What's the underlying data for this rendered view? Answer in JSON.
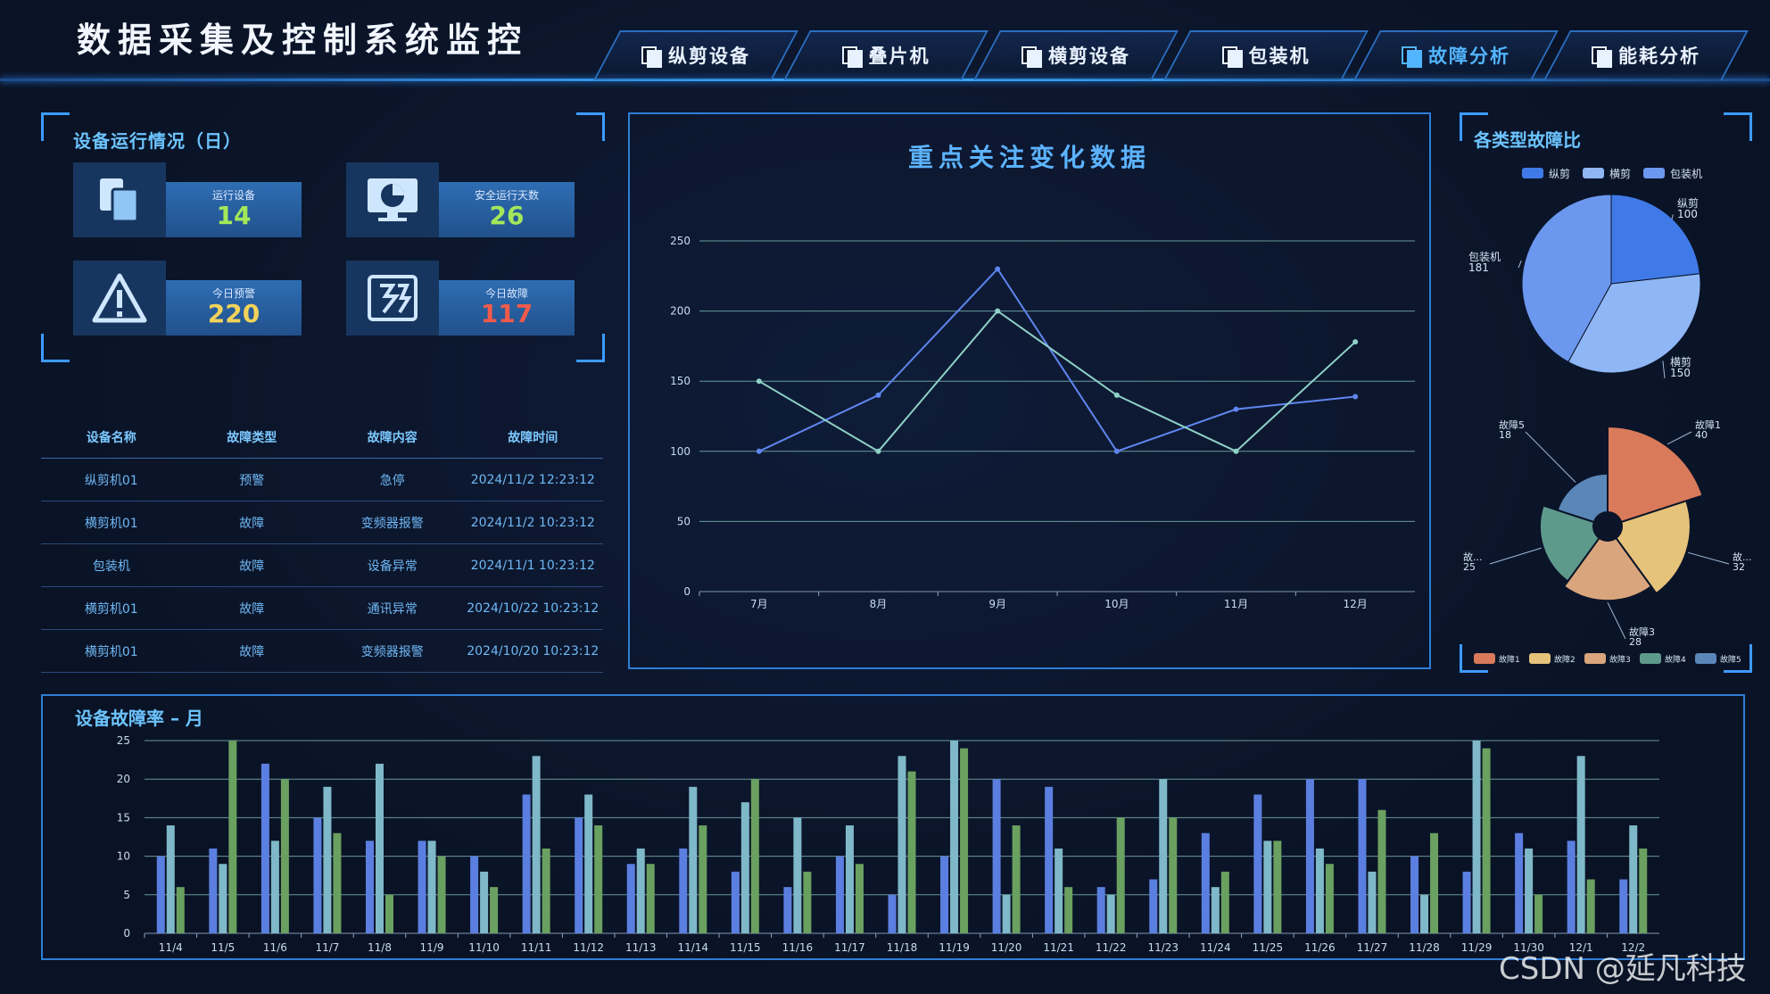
{
  "header": {
    "title": "数据采集及控制系统监控"
  },
  "nav": [
    {
      "label": "纵剪设备",
      "active": false
    },
    {
      "label": "叠片机",
      "active": false
    },
    {
      "label": "横剪设备",
      "active": false
    },
    {
      "label": "包装机",
      "active": false
    },
    {
      "label": "故障分析",
      "active": true
    },
    {
      "label": "能耗分析",
      "active": false
    }
  ],
  "colors": {
    "accent": "#38a6ff",
    "title": "#6cc4ff",
    "green": "#a3e85a",
    "yellow": "#f2d35a",
    "red": "#f05a4a"
  },
  "status": {
    "title": "设备运行情况（日）",
    "items": [
      {
        "label": "运行设备",
        "value": "14",
        "icon": "devices-icon",
        "color": "#a3e85a"
      },
      {
        "label": "安全运行天数",
        "value": "26",
        "icon": "monitor-pie-icon",
        "color": "#a3e85a"
      },
      {
        "label": "今日预警",
        "value": "220",
        "icon": "warning-icon",
        "color": "#f2d35a"
      },
      {
        "label": "今日故障",
        "value": "117",
        "icon": "fault-icon",
        "color": "#f05a4a"
      }
    ]
  },
  "fault_table": {
    "headers": [
      "设备名称",
      "故障类型",
      "故障内容",
      "故障时间"
    ],
    "rows": [
      [
        "纵剪机01",
        "预警",
        "急停",
        "2024/11/2 12:23:12"
      ],
      [
        "横剪机01",
        "故障",
        "变频器报警",
        "2024/11/2 10:23:12"
      ],
      [
        "包装机",
        "故障",
        "设备异常",
        "2024/11/1 10:23:12"
      ],
      [
        "横剪机01",
        "故障",
        "通讯异常",
        "2024/10/22 10:23:12"
      ],
      [
        "横剪机01",
        "故障",
        "变频器报警",
        "2024/10/20 10:23:12"
      ]
    ]
  },
  "chart_data": [
    {
      "type": "line",
      "title": "重点关注变化数据",
      "x": [
        "7月",
        "8月",
        "9月",
        "10月",
        "11月",
        "12月"
      ],
      "ylim": [
        0,
        250
      ],
      "yticks": [
        0,
        50,
        100,
        150,
        200,
        250
      ],
      "grid": true,
      "series": [
        {
          "values": [
            100,
            140,
            230,
            100,
            130,
            139
          ],
          "color": "#5f86ef"
        },
        {
          "values": [
            150,
            100,
            200,
            140,
            100,
            178
          ],
          "color": "#8fd1c8"
        }
      ]
    },
    {
      "type": "pie",
      "title": "各类型故障比",
      "legend": "top",
      "slices": [
        {
          "name": "纵剪",
          "value": 100,
          "color": "#3f7ae8"
        },
        {
          "name": "横剪",
          "value": 150,
          "color": "#8fb6f5"
        },
        {
          "name": "包装机",
          "value": 181,
          "color": "#6b97ee"
        }
      ]
    },
    {
      "type": "pie",
      "subtype": "rose",
      "legend": "bottom",
      "slices": [
        {
          "name": "故障1",
          "label": "故障1",
          "value": 40,
          "color": "#d97a5a"
        },
        {
          "name": "故障2",
          "label": "故...",
          "value": 32,
          "color": "#e6c37a"
        },
        {
          "name": "故障3",
          "label": "故障3",
          "value": 28,
          "color": "#d9a57c"
        },
        {
          "name": "故障4",
          "label": "故...",
          "value": 25,
          "color": "#5e9a8c"
        },
        {
          "name": "故障5",
          "label": "故障5",
          "value": 18,
          "color": "#5b86b8"
        }
      ]
    },
    {
      "type": "bar",
      "title": "设备故障率 – 月",
      "ylim": [
        0,
        25
      ],
      "yticks": [
        0,
        5,
        10,
        15,
        20,
        25
      ],
      "grid": true,
      "categories": [
        "11/4",
        "11/5",
        "11/6",
        "11/7",
        "11/8",
        "11/9",
        "11/10",
        "11/11",
        "11/12",
        "11/13",
        "11/14",
        "11/15",
        "11/16",
        "11/17",
        "11/18",
        "11/19",
        "11/20",
        "11/21",
        "11/22",
        "11/23",
        "11/24",
        "11/25",
        "11/26",
        "11/27",
        "11/28",
        "11/29",
        "11/30",
        "12/1",
        "12/2"
      ],
      "series": [
        {
          "values": [
            10,
            11,
            22,
            15,
            12,
            12,
            10,
            18,
            15,
            9,
            11,
            8,
            6,
            10,
            5,
            10,
            20,
            19,
            6,
            7,
            13,
            18,
            20,
            20,
            10,
            8,
            13,
            12,
            7
          ],
          "color": "#5b7fe0"
        },
        {
          "values": [
            14,
            9,
            12,
            19,
            22,
            12,
            8,
            23,
            18,
            11,
            19,
            17,
            15,
            14,
            23,
            25,
            5,
            11,
            5,
            20,
            6,
            12,
            11,
            8,
            5,
            25,
            11,
            23,
            14
          ],
          "color": "#7fb8c8"
        },
        {
          "values": [
            6,
            25,
            20,
            13,
            5,
            10,
            6,
            11,
            14,
            9,
            14,
            20,
            8,
            9,
            21,
            24,
            14,
            6,
            15,
            15,
            8,
            12,
            9,
            16,
            13,
            24,
            5,
            7,
            11
          ],
          "color": "#6aa060"
        }
      ]
    }
  ],
  "watermark": "CSDN @延凡科技"
}
